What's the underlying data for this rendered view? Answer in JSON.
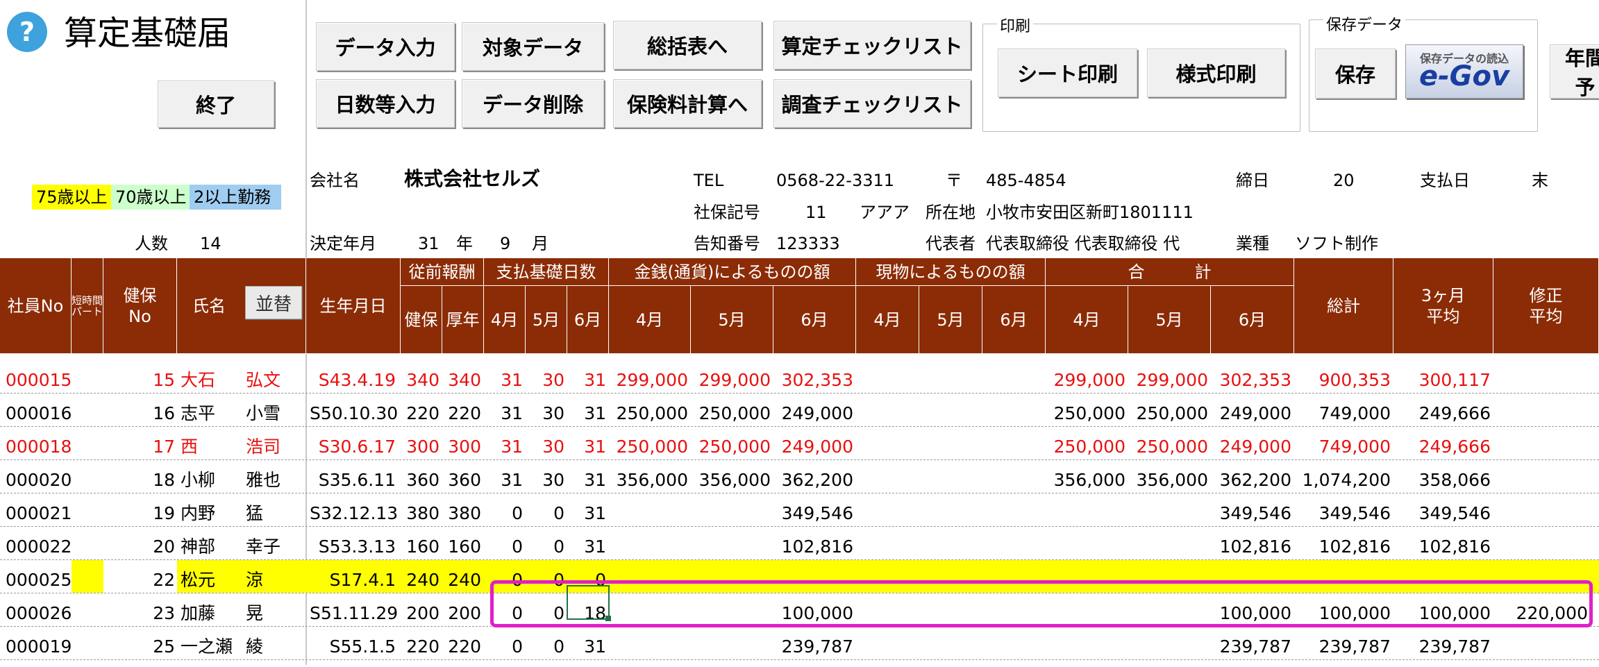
{
  "app": {
    "title": "算定基礎届",
    "help_icon": "?"
  },
  "buttons": {
    "end": "終了",
    "data_input": "データ入力",
    "target_data": "対象データ",
    "to_summary": "総括表へ",
    "calc_checklist": "算定チェックリスト",
    "days_input": "日数等入力",
    "data_delete": "データ削除",
    "to_premium_calc": "保険料計算へ",
    "survey_checklist": "調査チェックリスト",
    "sheet_print": "シート印刷",
    "form_print": "様式印刷",
    "save": "保存",
    "annual": "年間予"
  },
  "groups": {
    "print": "印刷",
    "saved_data": "保存データ"
  },
  "egov": {
    "caption": "保存データの読込",
    "label": "e-Gov"
  },
  "legend": [
    {
      "label": "75歳以上",
      "color": "#ffff00"
    },
    {
      "label": "70歳以上",
      "color": "#ccffcc"
    },
    {
      "label": "2以上勤務",
      "color": "#9fcdf2"
    }
  ],
  "company": {
    "count_label": "人数",
    "count": "14",
    "name_label": "会社名",
    "name": "株式会社セルズ",
    "year_label": "決定年月",
    "year": "31",
    "year_unit": "年",
    "month": "9",
    "month_unit": "月",
    "tel_label": "TEL",
    "tel": "0568-22-3311",
    "zip_label": "〒",
    "zip": "485-4854",
    "closing_label": "締日",
    "closing": "20",
    "payday_label": "支払日",
    "payday": "末",
    "insurance_no_label": "社保記号",
    "insurance_no": "11",
    "insurance_kana": "アアア",
    "address_label": "所在地",
    "address": "小牧市安田区新町1801111",
    "notice_label": "告知番号",
    "notice_no": "123333",
    "rep_label": "代表者",
    "rep": "代表取締役 代表取締役 代",
    "industry_label": "業種",
    "industry": "ソフト制作"
  },
  "table": {
    "headers": {
      "emp_no": "社員No",
      "part": "短時間\nパート",
      "kenpo_no": "健保\nNo",
      "name": "氏名",
      "sort": "並替",
      "birth": "生年月日",
      "prev_pay": "従前報酬",
      "kenpo": "健保",
      "kosei": "厚年",
      "days": "支払基礎日数",
      "cash": "金銭(通貨)によるものの額",
      "kind": "現物によるものの額",
      "total": "合　　　計",
      "apr": "4月",
      "may": "5月",
      "jun": "6月",
      "grand_total": "総計",
      "avg3": "3ヶ月\n平均",
      "revised_avg": "修正\n平均"
    },
    "rows": [
      {
        "emp": "000015",
        "no": "15",
        "last": "大石",
        "first": "弘文",
        "birth": "S43.4.19",
        "kenpo": "340",
        "kosei": "340",
        "d4": "31",
        "d5": "30",
        "d6": "31",
        "c4": "299,000",
        "c5": "299,000",
        "c6": "302,353",
        "k4": "",
        "k5": "",
        "k6": "",
        "t4": "299,000",
        "t5": "299,000",
        "t6": "302,353",
        "total": "900,353",
        "avg": "300,117",
        "rev": "",
        "style": "red"
      },
      {
        "emp": "000016",
        "no": "16",
        "last": "志平",
        "first": "小雪",
        "birth": "S50.10.30",
        "kenpo": "220",
        "kosei": "220",
        "d4": "31",
        "d5": "30",
        "d6": "31",
        "c4": "250,000",
        "c5": "250,000",
        "c6": "249,000",
        "k4": "",
        "k5": "",
        "k6": "",
        "t4": "250,000",
        "t5": "250,000",
        "t6": "249,000",
        "total": "749,000",
        "avg": "249,666",
        "rev": "",
        "style": "normal"
      },
      {
        "emp": "000018",
        "no": "17",
        "last": "西",
        "first": "浩司",
        "birth": "S30.6.17",
        "kenpo": "300",
        "kosei": "300",
        "d4": "31",
        "d5": "30",
        "d6": "31",
        "c4": "250,000",
        "c5": "250,000",
        "c6": "249,000",
        "k4": "",
        "k5": "",
        "k6": "",
        "t4": "250,000",
        "t5": "250,000",
        "t6": "249,000",
        "total": "749,000",
        "avg": "249,666",
        "rev": "",
        "style": "red"
      },
      {
        "emp": "000020",
        "no": "18",
        "last": "小柳",
        "first": "雅也",
        "birth": "S35.6.11",
        "kenpo": "360",
        "kosei": "360",
        "d4": "31",
        "d5": "30",
        "d6": "31",
        "c4": "356,000",
        "c5": "356,000",
        "c6": "362,200",
        "k4": "",
        "k5": "",
        "k6": "",
        "t4": "356,000",
        "t5": "356,000",
        "t6": "362,200",
        "total": "1,074,200",
        "avg": "358,066",
        "rev": "",
        "style": "normal"
      },
      {
        "emp": "000021",
        "no": "19",
        "last": "内野",
        "first": "猛",
        "birth": "S32.12.13",
        "kenpo": "380",
        "kosei": "380",
        "d4": "0",
        "d5": "0",
        "d6": "31",
        "c4": "",
        "c5": "",
        "c6": "349,546",
        "k4": "",
        "k5": "",
        "k6": "",
        "t4": "",
        "t5": "",
        "t6": "349,546",
        "total": "349,546",
        "avg": "349,546",
        "rev": "",
        "style": "normal"
      },
      {
        "emp": "000022",
        "no": "20",
        "last": "神部",
        "first": "幸子",
        "birth": "S53.3.13",
        "kenpo": "160",
        "kosei": "160",
        "d4": "0",
        "d5": "0",
        "d6": "31",
        "c4": "",
        "c5": "",
        "c6": "102,816",
        "k4": "",
        "k5": "",
        "k6": "",
        "t4": "",
        "t5": "",
        "t6": "102,816",
        "total": "102,816",
        "avg": "102,816",
        "rev": "",
        "style": "normal"
      },
      {
        "emp": "000025",
        "no": "22",
        "last": "松元",
        "first": "涼",
        "birth": "S17.4.1",
        "kenpo": "240",
        "kosei": "240",
        "d4": "0",
        "d5": "0",
        "d6": "0",
        "c4": "",
        "c5": "",
        "c6": "",
        "k4": "",
        "k5": "",
        "k6": "",
        "t4": "",
        "t5": "",
        "t6": "",
        "total": "",
        "avg": "",
        "rev": "",
        "style": "yellow"
      },
      {
        "emp": "000026",
        "no": "23",
        "last": "加藤",
        "first": "晃",
        "birth": "S51.11.29",
        "kenpo": "200",
        "kosei": "200",
        "d4": "0",
        "d5": "0",
        "d6": "18",
        "c4": "",
        "c5": "",
        "c6": "100,000",
        "k4": "",
        "k5": "",
        "k6": "",
        "t4": "",
        "t5": "",
        "t6": "100,000",
        "total": "100,000",
        "avg": "100,000",
        "rev": "220,000",
        "style": "normal"
      },
      {
        "emp": "000019",
        "no": "25",
        "last": "一之瀬",
        "first": "綾",
        "birth": "S55.1.5",
        "kenpo": "220",
        "kosei": "220",
        "d4": "0",
        "d5": "0",
        "d6": "31",
        "c4": "",
        "c5": "",
        "c6": "239,787",
        "k4": "",
        "k5": "",
        "k6": "",
        "t4": "",
        "t5": "",
        "t6": "239,787",
        "total": "239,787",
        "avg": "239,787",
        "rev": "",
        "style": "normal"
      }
    ]
  }
}
